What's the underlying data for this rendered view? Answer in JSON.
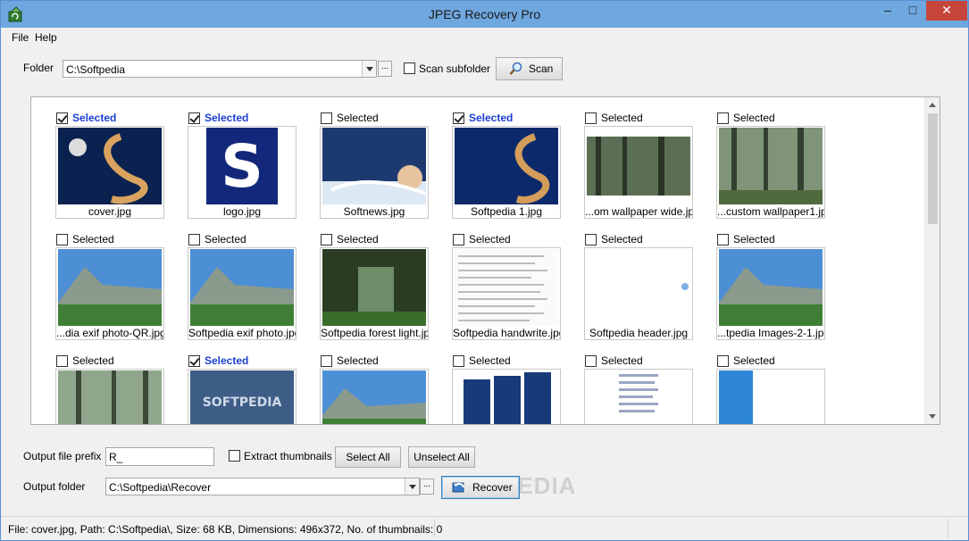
{
  "window": {
    "title": "JPEG Recovery Pro",
    "min": "–",
    "max": "□",
    "close": "✕"
  },
  "menu": {
    "file": "File",
    "help": "Help"
  },
  "folder": {
    "label": "Folder",
    "path": "C:\\Softpedia",
    "browse": "...",
    "scan_subfolder": "Scan subfolder",
    "scan_subfolder_checked": false,
    "scan_button": "Scan"
  },
  "tiles": [
    {
      "selected": true,
      "label": "Selected",
      "caption": "cover.jpg"
    },
    {
      "selected": true,
      "label": "Selected",
      "caption": "logo.jpg"
    },
    {
      "selected": false,
      "label": "Selected",
      "caption": "Softnews.jpg"
    },
    {
      "selected": true,
      "label": "Selected",
      "caption": "Softpedia 1.jpg"
    },
    {
      "selected": false,
      "label": "Selected",
      "caption": "...om wallpaper wide.jpg"
    },
    {
      "selected": false,
      "label": "Selected",
      "caption": "...custom wallpaper1.jpg"
    },
    {
      "selected": false,
      "label": "Selected",
      "caption": "...dia exif photo-QR.jpg"
    },
    {
      "selected": false,
      "label": "Selected",
      "caption": "Softpedia exif photo.jpg"
    },
    {
      "selected": false,
      "label": "Selected",
      "caption": "Softpedia forest light.jpg"
    },
    {
      "selected": false,
      "label": "Selected",
      "caption": "Softpedia handwrite.jpg"
    },
    {
      "selected": false,
      "label": "Selected",
      "caption": "Softpedia header.jpg"
    },
    {
      "selected": false,
      "label": "Selected",
      "caption": "...tpedia Images-2-1.jpg"
    },
    {
      "selected": false,
      "label": "Selected",
      "caption": ""
    },
    {
      "selected": true,
      "label": "Selected",
      "caption": ""
    },
    {
      "selected": false,
      "label": "Selected",
      "caption": ""
    },
    {
      "selected": false,
      "label": "Selected",
      "caption": ""
    },
    {
      "selected": false,
      "label": "Selected",
      "caption": ""
    },
    {
      "selected": false,
      "label": "Selected",
      "caption": ""
    }
  ],
  "output": {
    "prefix_label": "Output file prefix",
    "prefix_value": "R_",
    "extract_thumbnails": "Extract thumbnails",
    "extract_checked": false,
    "select_all": "Select All",
    "unselect_all": "Unselect All",
    "folder_label": "Output folder",
    "folder_path": "C:\\Softpedia\\Recover",
    "browse": "...",
    "recover": "Recover"
  },
  "status": "File: cover.jpg, Path: C:\\Softpedia\\, Size: 68 KB, Dimensions: 496x372, No. of thumbnails: 0",
  "watermark": "PEDIA",
  "colors": {
    "selected_text": "#1b3fd1",
    "titlebar": "#6fa7df",
    "close": "#c7463b"
  }
}
